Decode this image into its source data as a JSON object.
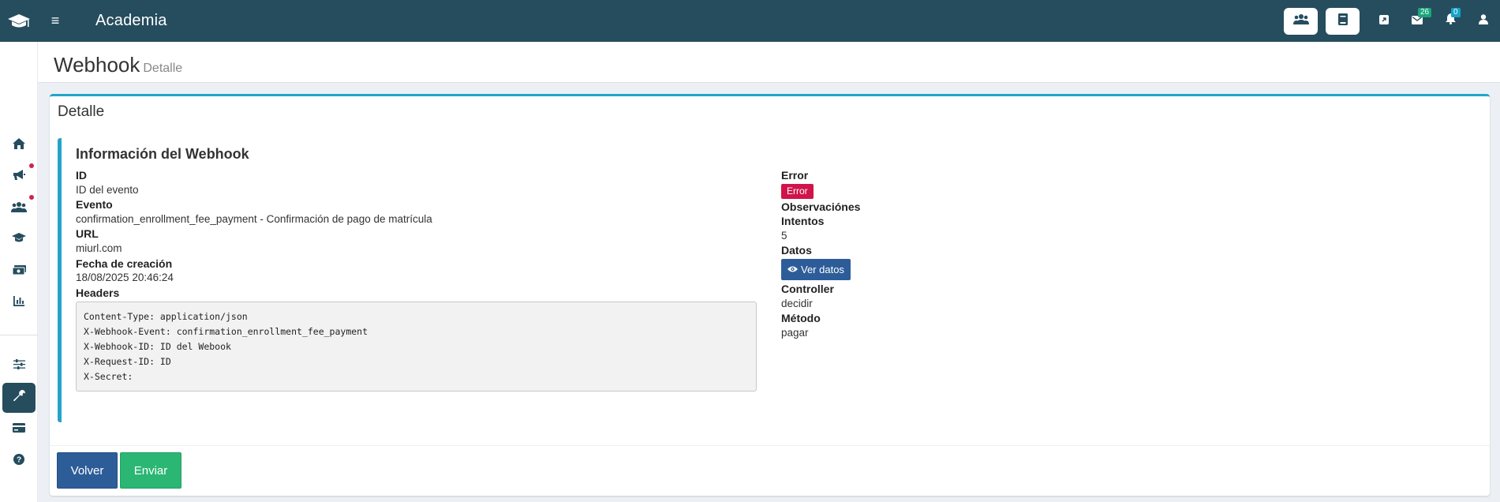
{
  "app": {
    "title": "Academia",
    "logo_icon": "graduation-cap-icon",
    "menu_icon": "hamburger-icon"
  },
  "topbar": {
    "buttons": [
      {
        "icon": "users-icon"
      },
      {
        "icon": "book-icon"
      },
      {
        "icon": "external-link-icon"
      },
      {
        "icon": "mail-icon",
        "badge": "26"
      },
      {
        "icon": "bell-icon",
        "badge": "0"
      },
      {
        "icon": "user-icon"
      }
    ]
  },
  "sidebar": {
    "items": [
      {
        "icon": "home-icon"
      },
      {
        "icon": "megaphone-icon",
        "dot": true
      },
      {
        "icon": "users-icon",
        "dot": true
      },
      {
        "icon": "graduation-cap-icon"
      },
      {
        "icon": "money-icon"
      },
      {
        "icon": "chart-icon"
      },
      {
        "icon": "sliders-icon"
      },
      {
        "icon": "wrench-icon",
        "active": true
      },
      {
        "icon": "credit-card-icon"
      },
      {
        "icon": "help-icon"
      }
    ]
  },
  "page": {
    "title": "Webhook",
    "subtitle": "Detalle"
  },
  "card": {
    "title": "Detalle",
    "section_title": "Información del Webhook",
    "left": {
      "id_label": "ID",
      "id_value": "ID del evento",
      "evento_label": "Evento",
      "evento_value": "confirmation_enrollment_fee_payment - Confirmación de pago de matrícula",
      "url_label": "URL",
      "url_value": "miurl.com",
      "fecha_label": "Fecha de creación",
      "fecha_value": "18/08/2025 20:46:24",
      "headers_label": "Headers",
      "headers": [
        "Content-Type: application/json",
        "X-Webhook-Event: confirmation_enrollment_fee_payment",
        "X-Webhook-ID: ID del Webook",
        "X-Request-ID: ID",
        "X-Secret:"
      ]
    },
    "right": {
      "error_label": "Error",
      "error_badge": "Error",
      "error_color": "#d0144a",
      "observaciones_label": "Observaciónes",
      "intentos_label": "Intentos",
      "intentos_value": "5",
      "datos_label": "Datos",
      "datos_button": "Ver datos",
      "controller_label": "Controller",
      "controller_value": "decidir",
      "metodo_label": "Método",
      "metodo_value": "pagar"
    },
    "buttons": {
      "volver": "Volver",
      "enviar": "Enviar"
    }
  },
  "colors": {
    "topbar": "#254d5e",
    "accent": "#24a4c9",
    "primary_button": "#2d5d99",
    "success_button": "#2bb673"
  }
}
